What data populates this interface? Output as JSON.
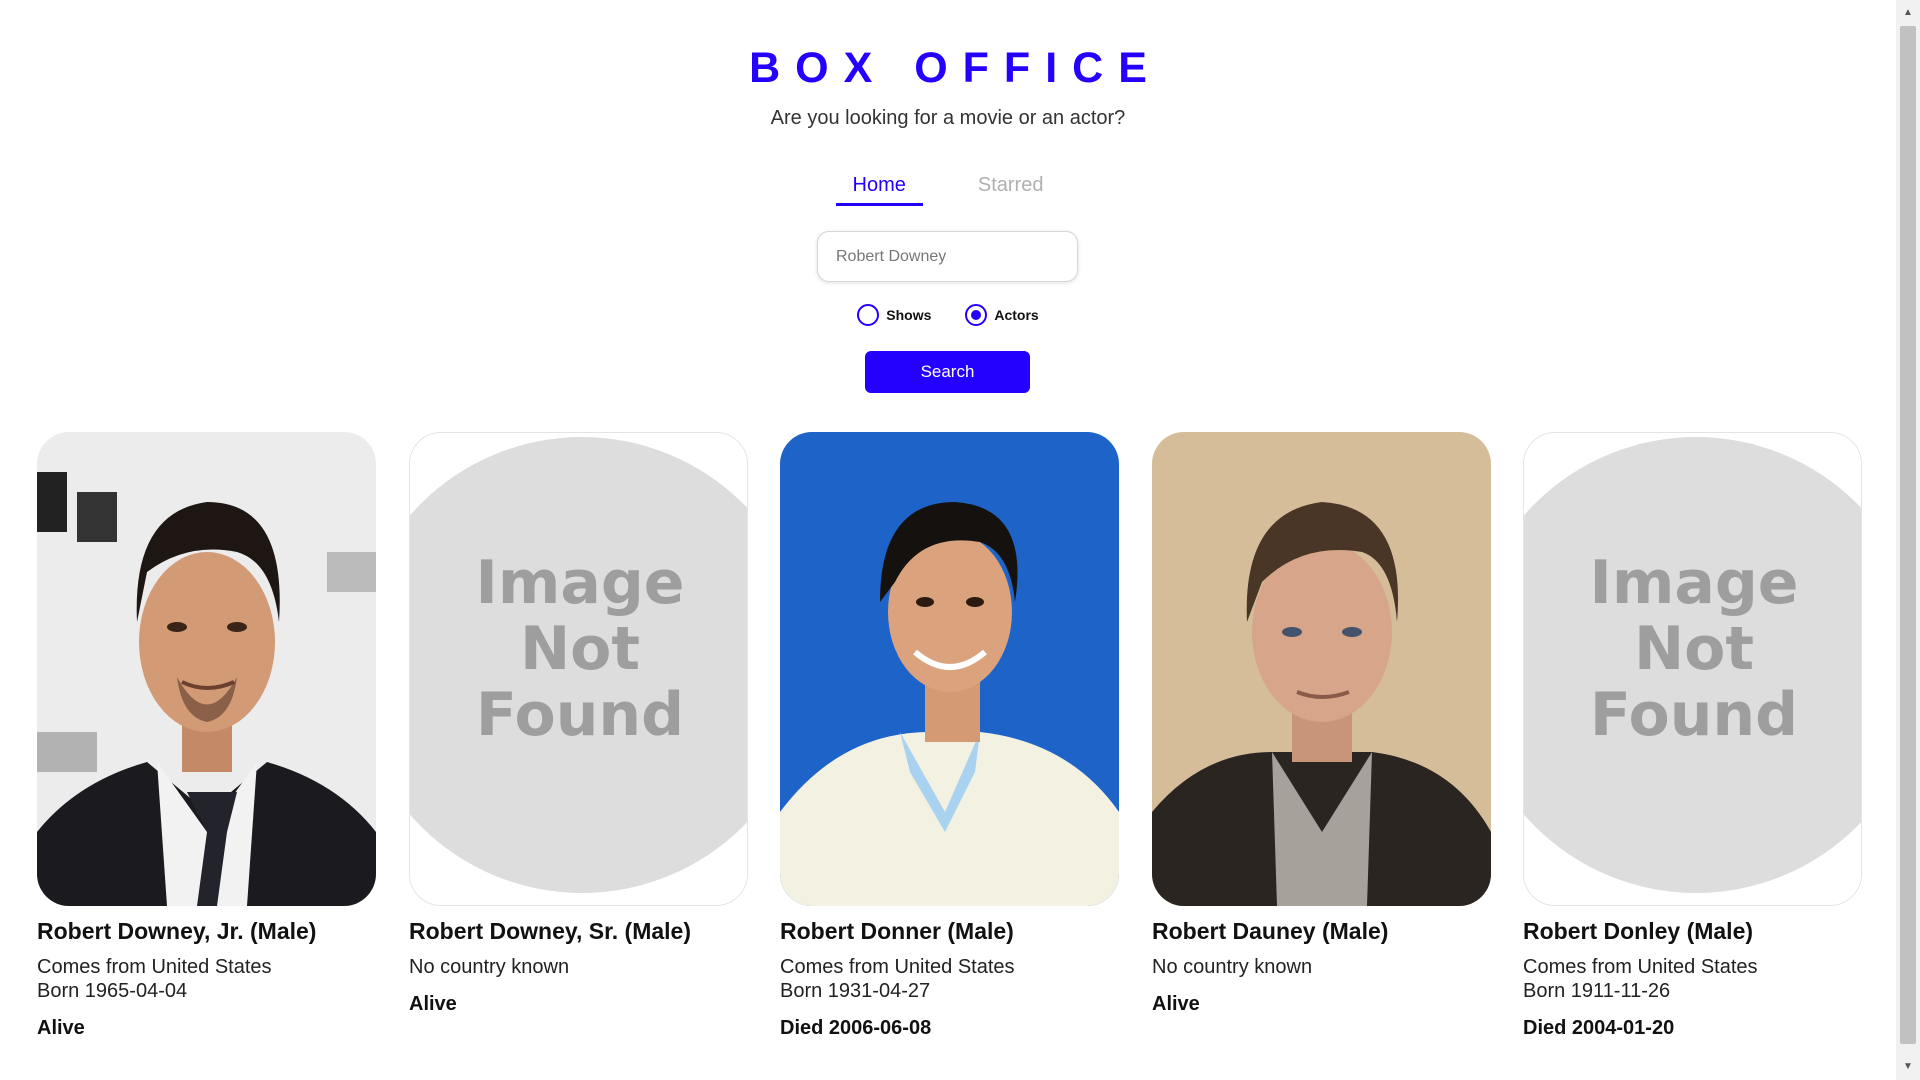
{
  "header": {
    "title": "BOX OFFICE",
    "subtitle": "Are you looking for a movie or an actor?"
  },
  "nav": {
    "tabs": [
      {
        "label": "Home",
        "active": true
      },
      {
        "label": "Starred",
        "active": false
      }
    ]
  },
  "search": {
    "value": "Robert Downey",
    "placeholder": "Robert Downey",
    "options": [
      {
        "label": "Shows",
        "selected": false
      },
      {
        "label": "Actors",
        "selected": true
      }
    ],
    "button_label": "Search"
  },
  "colors": {
    "accent": "#2400ff",
    "muted_tab": "#b0b0b0"
  },
  "results": [
    {
      "name": "Robert Downey, Jr. (Male)",
      "country": "Comes from United States",
      "born": "Born 1965-04-04",
      "status": "Alive",
      "image": "photo"
    },
    {
      "name": "Robert Downey, Sr. (Male)",
      "country": "No country known",
      "born": "",
      "status": "Alive",
      "image": "not-found"
    },
    {
      "name": "Robert Donner (Male)",
      "country": "Comes from United States",
      "born": "Born 1931-04-27",
      "status": "Died 2006-06-08",
      "image": "photo"
    },
    {
      "name": "Robert Dauney (Male)",
      "country": "No country known",
      "born": "",
      "status": "Alive",
      "image": "photo"
    },
    {
      "name": "Robert Donley (Male)",
      "country": "Comes from United States",
      "born": "Born 1911-11-26",
      "status": "Died 2004-01-20",
      "image": "not-found"
    }
  ],
  "placeholder_image_text": [
    "Image",
    "Not",
    "Found"
  ]
}
